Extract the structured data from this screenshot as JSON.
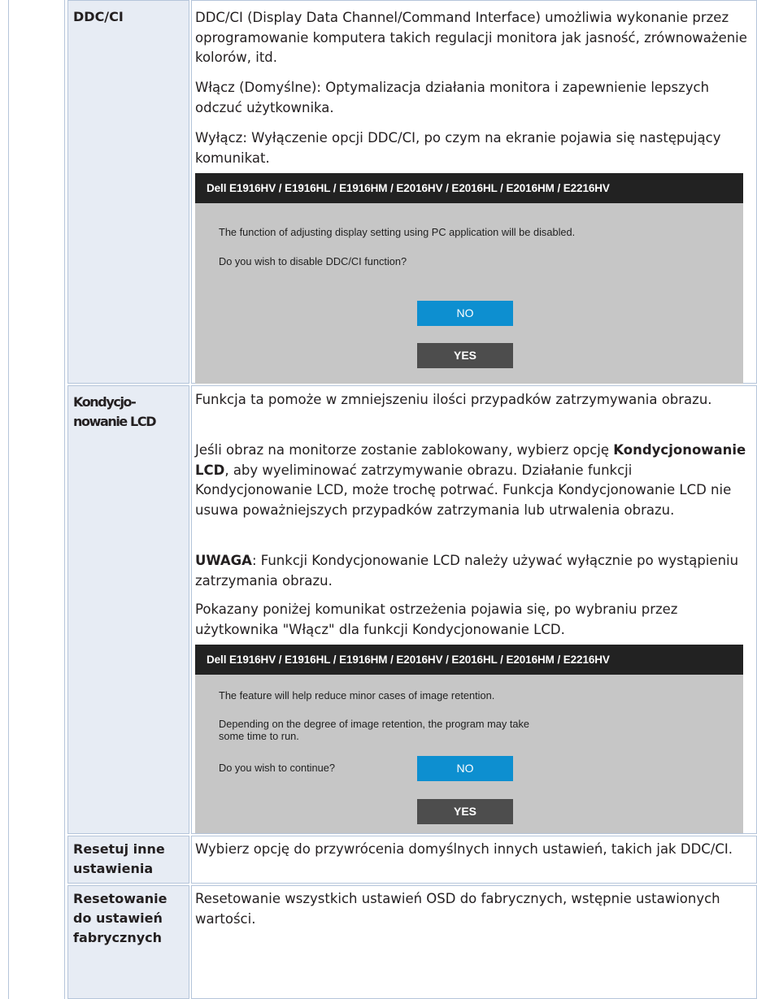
{
  "rows": [
    {
      "label": "DDC/CI",
      "paragraphs": [
        "DDC/CI (Display Data Channel/Command Interface) umożliwia wykonanie przez oprogramowanie komputera takich regulacji monitora jak jasność, zrównoważenie kolorów, itd.",
        "Włącz (Domyślne): Optymalizacja działania monitora i zapewnienie lepszych odczuć użytkownika.",
        "Wyłącz: Wyłączenie opcji DDC/CI, po czym na ekranie pojawia się następujący komunikat."
      ],
      "dialog": {
        "title": "Dell E1916HV / E1916HL / E1916HM / E2016HV / E2016HL / E2016HM / E2216HV",
        "lines": [
          "The function of adjusting display setting using PC application will be disabled.",
          "Do you wish to disable DDC/CI function?"
        ],
        "no_label": "NO",
        "yes_label": "YES"
      }
    },
    {
      "label_line1": "Kondycjo-",
      "label_line2": "nowanie LCD",
      "p1": "Funkcja ta pomoże w zmniejszeniu ilości przypadków zatrzymywania obrazu.",
      "p2_pre": "Jeśli obraz na monitorze zostanie zablokowany, wybierz opcję ",
      "p2_bold": "Kondycjonowanie LCD",
      "p2_post": ", aby wyeliminować zatrzymywanie obrazu. Działanie funkcji Kondycjonowanie LCD, może trochę potrwać. Funkcja Kondycjonowanie LCD nie usuwa poważniejszych przypadków zatrzymania lub utrwalenia obrazu.",
      "p3_bold": "UWAGA",
      "p3_post": ": Funkcji Kondycjonowanie LCD należy używać wyłącznie po wystąpieniu zatrzymania obrazu.",
      "p4": "Pokazany poniżej komunikat ostrzeżenia pojawia się, po wybraniu przez użytkownika \"Włącz\" dla funkcji Kondycjonowanie LCD.",
      "dialog": {
        "title": "Dell E1916HV / E1916HL / E1916HM / E2016HV / E2016HL / E2016HM / E2216HV",
        "line1": "The feature will help reduce minor cases of image retention.",
        "line2a": "Depending on the degree of image retention, the program may take",
        "line2b": "some time to run.",
        "line3": "Do you wish to continue?",
        "no_label": "NO",
        "yes_label": "YES"
      }
    },
    {
      "label_line1": "Resetuj inne",
      "label_line2": "ustawienia",
      "text": "Wybierz opcję do przywrócenia domyślnych innych ustawień, takich jak DDC/CI."
    },
    {
      "label_line1": "Resetowanie",
      "label_line2": "do ustawień",
      "label_line3": "fabrycznych",
      "text": "Resetowanie wszystkich ustawień OSD do fabrycznych, wstępnie ustawionych wartości."
    }
  ]
}
